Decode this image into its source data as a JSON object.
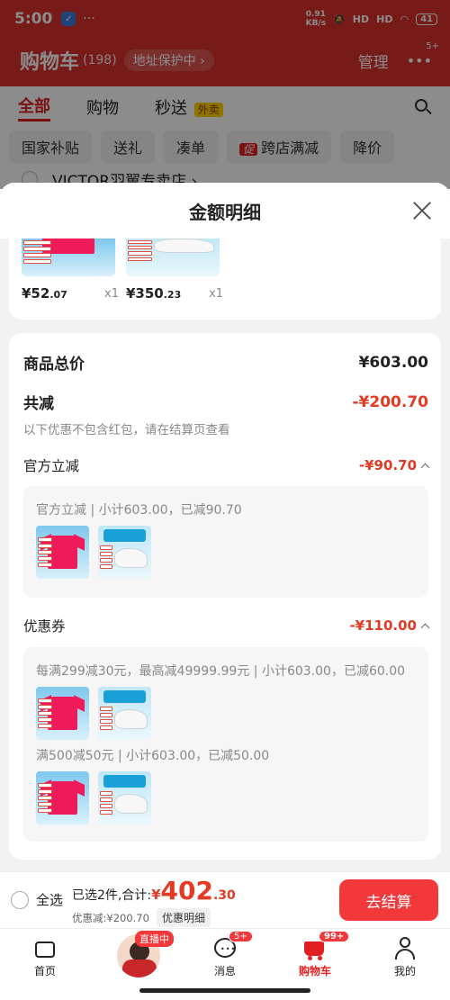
{
  "status_bar": {
    "time": "5:00",
    "net_speed_value": "0.91",
    "net_speed_unit": "KB/s",
    "signal_1": "HD",
    "signal_2": "HD",
    "battery": "41"
  },
  "cart_header": {
    "title": "购物车",
    "count": "(198)",
    "address_protect": "地址保护中",
    "manage": "管理",
    "more_badge": "5+"
  },
  "cart_tabs": {
    "all": "全部",
    "shopping": "购物",
    "flash": "秒送",
    "flash_badge": "外卖"
  },
  "filter_chips": {
    "chip1": "国家补贴",
    "chip2": "送礼",
    "chip3": "凑单",
    "chip4_tag": "促",
    "chip4": "跨店满减",
    "chip5": "降价"
  },
  "store_name": "VICTOR羽翼专卖店 ›",
  "sheet": {
    "title": "金额明细",
    "items": [
      {
        "price_int": "¥52",
        "price_dec": ".07",
        "qty": "x1"
      },
      {
        "price_int": "¥350",
        "price_dec": ".23",
        "qty": "x1"
      }
    ],
    "total_label": "商品总价",
    "total_value": "¥603.00",
    "reduce_label": "共减",
    "reduce_value": "-¥200.70",
    "note": "以下优惠不包含红包，请在结算页查看",
    "official": {
      "label": "官方立减",
      "value": "-¥90.70",
      "line": "官方立减 | 小计603.00，已减90.70"
    },
    "coupon": {
      "label": "优惠券",
      "value": "-¥110.00",
      "line1": "每满299减30元，最高减49999.99元 | 小计603.00，已减60.00",
      "line2": "满500减50元 | 小计603.00，已减50.00"
    }
  },
  "checkout": {
    "select_all": "全选",
    "selected_text": "已选2件,合计:",
    "currency": "¥",
    "total_int": "402",
    "total_dec": ".30",
    "discount_text": "优惠减:¥200.70",
    "detail_label": "优惠明细",
    "checkout_label": "去结算"
  },
  "bottom_nav": {
    "home": "首页",
    "live_badge": "直播中",
    "messages": "消息",
    "messages_badge": "5+",
    "cart": "购物车",
    "cart_badge": "99+",
    "mine": "我的"
  },
  "colors": {
    "accent_red": "#e33a24",
    "header_red": "#d8322c",
    "button_red": "#f2383a"
  }
}
